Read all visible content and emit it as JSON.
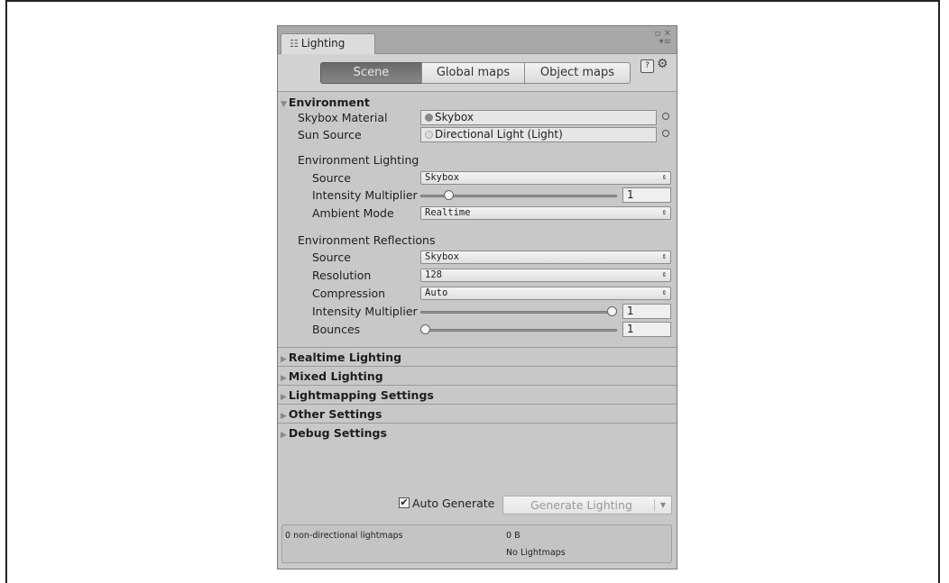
{
  "window": {
    "tab_label": "Lighting",
    "tab_icon": "lighting-icon"
  },
  "toolbar": {
    "tabs": [
      "Scene",
      "Global maps",
      "Object maps"
    ],
    "active_tab": "Scene"
  },
  "environment": {
    "header": "Environment",
    "skybox_material": {
      "label": "Skybox Material",
      "value": "Skybox"
    },
    "sun_source": {
      "label": "Sun Source",
      "value": "Directional Light (Light)"
    },
    "lighting": {
      "header": "Environment Lighting",
      "source": {
        "label": "Source",
        "value": "Skybox"
      },
      "intensity": {
        "label": "Intensity Multiplier",
        "value": "1",
        "slider_fraction": 0.125
      },
      "ambient_mode": {
        "label": "Ambient Mode",
        "value": "Realtime"
      }
    },
    "reflections": {
      "header": "Environment Reflections",
      "source": {
        "label": "Source",
        "value": "Skybox"
      },
      "resolution": {
        "label": "Resolution",
        "value": "128"
      },
      "compression": {
        "label": "Compression",
        "value": "Auto"
      },
      "intensity": {
        "label": "Intensity Multiplier",
        "value": "1",
        "slider_fraction": 1.0
      },
      "bounces": {
        "label": "Bounces",
        "value": "1",
        "slider_fraction": 0.0
      }
    }
  },
  "sections": [
    "Realtime Lighting",
    "Mixed Lighting",
    "Lightmapping Settings",
    "Other Settings",
    "Debug Settings"
  ],
  "generate": {
    "auto_generate_label": "Auto Generate",
    "auto_generate_checked": true,
    "button_label": "Generate Lighting"
  },
  "stats": {
    "lightmaps": "0 non-directional lightmaps",
    "size": "0 B",
    "status": "No Lightmaps"
  }
}
